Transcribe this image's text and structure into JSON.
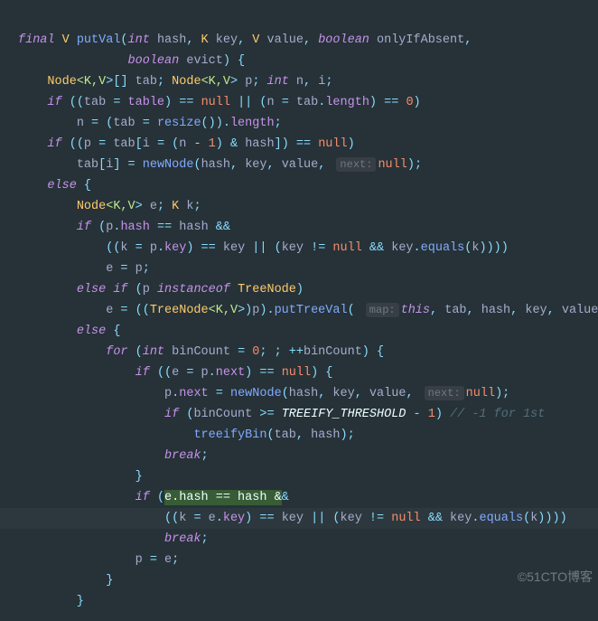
{
  "watermark": "©51CTO博客",
  "code": {
    "l1": {
      "t1": "final ",
      "t2": "V ",
      "t3": "putVal",
      "t4": "(",
      "t5": "int ",
      "t6": "hash",
      "t7": ", ",
      "t8": "K ",
      "t9": "key",
      "t10": ", ",
      "t11": "V ",
      "t12": "value",
      "t13": ", ",
      "t14": "boolean ",
      "t15": "onlyIfAbsent",
      "t16": ","
    },
    "l2": {
      "t1": "               ",
      "t2": "boolean ",
      "t3": "evict",
      "t4": ") {"
    },
    "l3": {
      "t1": "    ",
      "t2": "Node",
      "t3": "<K,",
      "t4": "V",
      "t5": ">",
      "t6": "[] ",
      "t7": "tab",
      "t8": "; ",
      "t9": "Node",
      "t10": "<K,",
      "t11": "V",
      "t12": "> ",
      "t13": "p",
      "t14": "; ",
      "t15": "int ",
      "t16": "n",
      "t17": ", ",
      "t18": "i",
      "t19": ";"
    },
    "l4": {
      "t1": "    ",
      "t2": "if ",
      "t3": "((",
      "t4": "tab ",
      "t5": "= ",
      "t6": "table",
      "t7": ") == ",
      "t8": "null ",
      "t9": "|| (",
      "t10": "n ",
      "t11": "= ",
      "t12": "tab",
      "t13": ".",
      "t14": "length",
      "t15": ") == ",
      "t16": "0",
      "t17": ")"
    },
    "l5": {
      "t1": "        ",
      "t2": "n ",
      "t3": "= (",
      "t4": "tab ",
      "t5": "= ",
      "t6": "resize",
      "t7": "()).",
      "t8": "length",
      "t9": ";"
    },
    "l6": {
      "t1": "    ",
      "t2": "if ",
      "t3": "((",
      "t4": "p ",
      "t5": "= ",
      "t6": "tab",
      "t7": "[",
      "t8": "i ",
      "t9": "= (",
      "t10": "n ",
      "t11": "- ",
      "t12": "1",
      "t13": ") & ",
      "t14": "hash",
      "t15": "]) == ",
      "t16": "null",
      "t17": ")"
    },
    "l7": {
      "t1": "        ",
      "t2": "tab",
      "t3": "[",
      "t4": "i",
      "t5": "] = ",
      "t6": "newNode",
      "t7": "(",
      "t8": "hash",
      "t9": ", ",
      "t10": "key",
      "t11": ", ",
      "t12": "value",
      "t13": ", ",
      "h1": "next:",
      "t14": "null",
      "t15": ");"
    },
    "l8": {
      "t1": "    ",
      "t2": "else ",
      "t3": "{"
    },
    "l9": {
      "t1": "        ",
      "t2": "Node",
      "t3": "<K,",
      "t4": "V",
      "t5": "> ",
      "t6": "e",
      "t7": "; ",
      "t8": "K ",
      "t9": "k",
      "t10": ";"
    },
    "l10": {
      "t1": "        ",
      "t2": "if ",
      "t3": "(",
      "t4": "p",
      "t5": ".",
      "t6": "hash ",
      "t7": "== ",
      "t8": "hash ",
      "t9": "&&"
    },
    "l11": {
      "t1": "            ((",
      "t2": "k ",
      "t3": "= ",
      "t4": "p",
      "t5": ".",
      "t6": "key",
      "t7": ") == ",
      "t8": "key ",
      "t9": "|| (",
      "t10": "key ",
      "t11": "!= ",
      "t12": "null ",
      "t13": "&& ",
      "t14": "key",
      "t15": ".",
      "t16": "equals",
      "t17": "(",
      "t18": "k",
      "t19": "))))"
    },
    "l12": {
      "t1": "            ",
      "t2": "e ",
      "t3": "= ",
      "t4": "p",
      "t5": ";"
    },
    "l13": {
      "t1": "        ",
      "t2": "else if ",
      "t3": "(",
      "t4": "p ",
      "t5": "instanceof ",
      "t6": "TreeNode",
      "t7": ")"
    },
    "l14": {
      "t1": "            ",
      "t2": "e ",
      "t3": "= ((",
      "t4": "TreeNode",
      "t5": "<K,",
      "t6": "V",
      "t7": ">)",
      "t8": "p",
      "t9": ").",
      "t10": "putTreeVal",
      "t11": "( ",
      "h1": "map:",
      "t12": "this",
      "t13": ", ",
      "t14": "tab",
      "t15": ", ",
      "t16": "hash",
      "t17": ", ",
      "t18": "key",
      "t19": ", ",
      "t20": "value",
      "t21": ");"
    },
    "l15": {
      "t1": "        ",
      "t2": "else ",
      "t3": "{"
    },
    "l16": {
      "t1": "            ",
      "t2": "for ",
      "t3": "(",
      "t4": "int ",
      "t5": "binCount ",
      "t6": "= ",
      "t7": "0",
      "t8": "; ; ++",
      "t9": "binCount",
      "t10": ") {"
    },
    "l17": {
      "t1": "                ",
      "t2": "if ",
      "t3": "((",
      "t4": "e ",
      "t5": "= ",
      "t6": "p",
      "t7": ".",
      "t8": "next",
      "t9": ") == ",
      "t10": "null",
      "t11": ") {"
    },
    "l18": {
      "t1": "                    ",
      "t2": "p",
      "t3": ".",
      "t4": "next ",
      "t5": "= ",
      "t6": "newNode",
      "t7": "(",
      "t8": "hash",
      "t9": ", ",
      "t10": "key",
      "t11": ", ",
      "t12": "value",
      "t13": ", ",
      "h1": "next:",
      "t14": "null",
      "t15": ");"
    },
    "l19": {
      "t1": "                    ",
      "t2": "if ",
      "t3": "(",
      "t4": "binCount ",
      "t5": ">= ",
      "t6": "TREEIFY_THRESHOLD ",
      "t7": "- ",
      "t8": "1",
      "t9": ") ",
      "t10": "// -1 for 1st"
    },
    "l20": {
      "t1": "                        ",
      "t2": "treeifyBin",
      "t3": "(",
      "t4": "tab",
      "t5": ", ",
      "t6": "hash",
      "t7": ");"
    },
    "l21": {
      "t1": "                    ",
      "t2": "break",
      "t3": ";"
    },
    "l22": {
      "t1": "                }"
    },
    "l23": {
      "t1": "                ",
      "t2": "if ",
      "t3": "(",
      "hl": "e.hash == hash &",
      "t4": "&"
    },
    "l24": {
      "t1": "                    ((",
      "t2": "k ",
      "t3": "= ",
      "t4": "e",
      "t5": ".",
      "t6": "key",
      "t7": ") == ",
      "t8": "key ",
      "t9": "|| (",
      "t10": "key ",
      "t11": "!= ",
      "t12": "null ",
      "t13": "&& ",
      "t14": "key",
      "t15": ".",
      "t16": "equals",
      "t17": "(",
      "t18": "k",
      "t19": "))))"
    },
    "l25": {
      "t1": "                    ",
      "t2": "break",
      "t3": ";"
    },
    "l26": {
      "t1": "                ",
      "t2": "p ",
      "t3": "= ",
      "t4": "e",
      "t5": ";"
    },
    "l27": {
      "t1": "            }"
    },
    "l28": {
      "t1": "        }"
    }
  }
}
